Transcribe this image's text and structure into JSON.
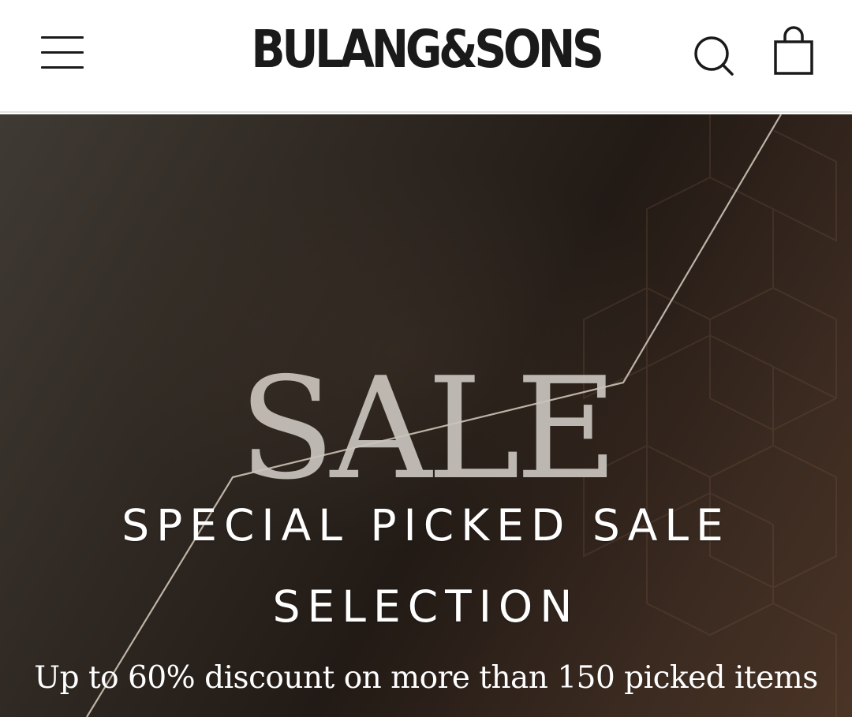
{
  "header": {
    "logo_text": "BULANG&SONS",
    "menu_icon": "hamburger-menu-icon",
    "search_icon": "search-icon",
    "cart_icon": "shopping-bag-icon"
  },
  "hero": {
    "background_word": "SALE",
    "title": "SPECIAL PICKED SALE SELECTION",
    "subtitle": "Up to 60% discount on more than 150 picked items"
  },
  "colors": {
    "header_bg": "#ffffff",
    "header_text": "#1a1a1a",
    "hero_bg_dark": "#2d2620",
    "hero_text": "#ffffff",
    "sale_word": "#c9c4bd",
    "accent_line": "#bdb3a6"
  }
}
